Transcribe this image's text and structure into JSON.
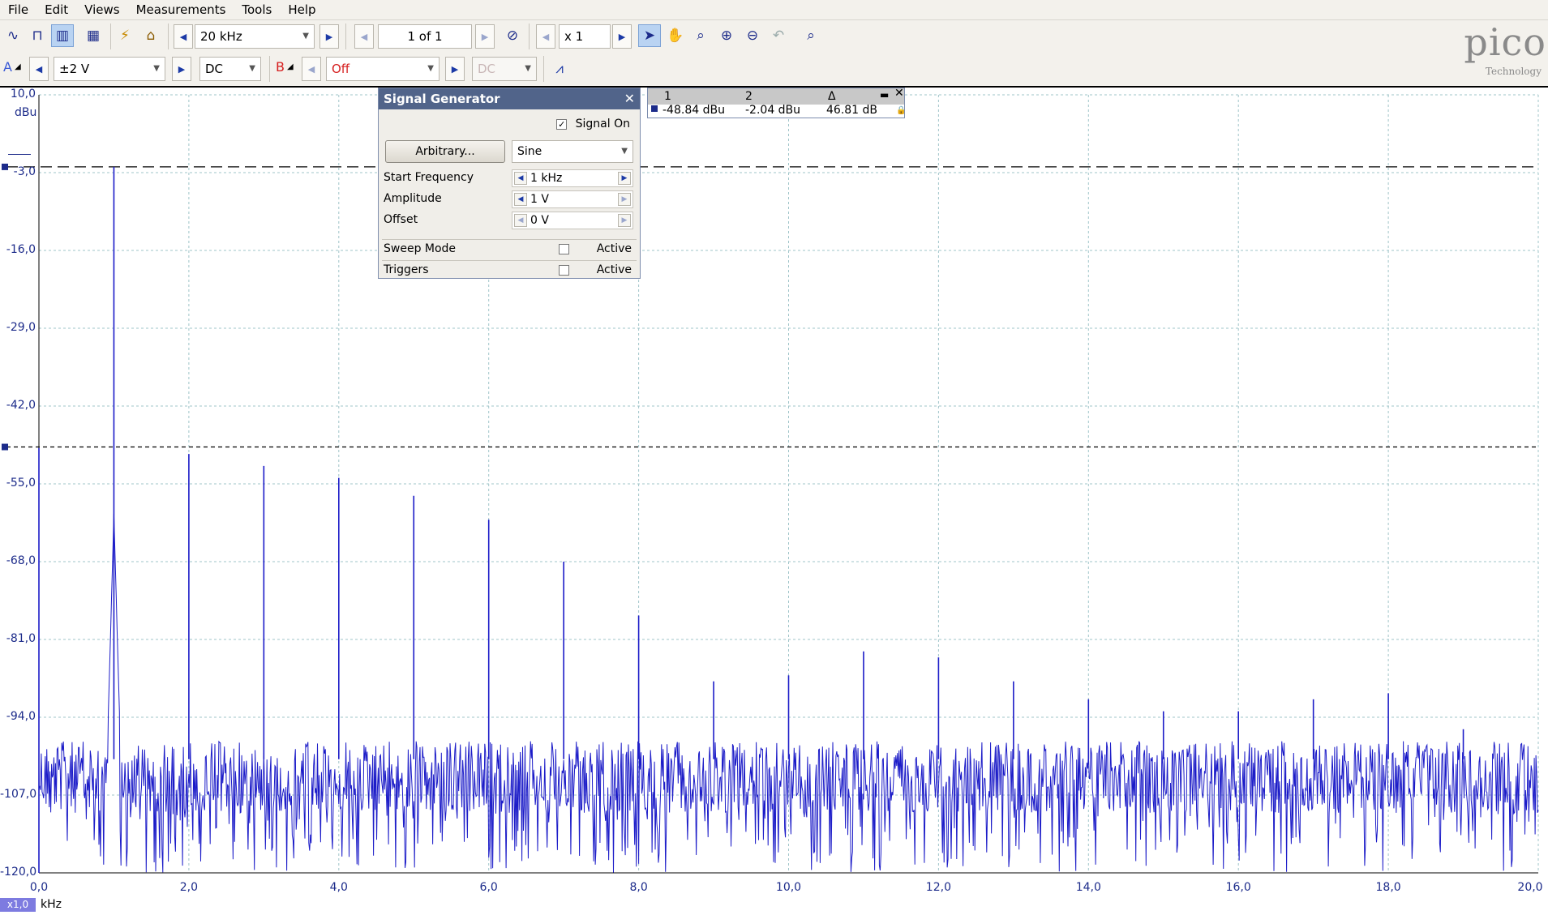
{
  "menu": [
    "File",
    "Edit",
    "Views",
    "Measurements",
    "Tools",
    "Help"
  ],
  "toolbar1": {
    "timebase": "20 kHz",
    "page": "1 of 1",
    "zoom": "x 1"
  },
  "toolbar2": {
    "channel_a_label": "A",
    "channel_a_range": "±2 V",
    "channel_a_coupling": "DC",
    "channel_b_label": "B",
    "channel_b_range": "Off",
    "channel_b_coupling": "DC"
  },
  "logo": {
    "word": "pico",
    "sub": "Technology"
  },
  "signal_generator": {
    "title": "Signal Generator",
    "signal_on_label": "Signal On",
    "signal_on": true,
    "arbitrary_button": "Arbitrary...",
    "waveform": "Sine",
    "start_frequency_label": "Start Frequency",
    "start_frequency": "1 kHz",
    "amplitude_label": "Amplitude",
    "amplitude": "1 V",
    "offset_label": "Offset",
    "offset": "0 V",
    "sweep_mode_label": "Sweep Mode",
    "triggers_label": "Triggers",
    "active_label": "Active"
  },
  "rulers": {
    "col1": "1",
    "col2": "2",
    "col3": "Δ",
    "val1": "-48.84 dBu",
    "val2": "-2.04 dBu",
    "delta": "46.81 dB"
  },
  "axis": {
    "y_unit": "dBu",
    "x_unit": "kHz",
    "x_zoom": "x1,0"
  },
  "colors": {
    "trace": "#1c1cc8",
    "axis_text": "#1c2b8a",
    "grid": "#9fc4c9",
    "titlebar": "#51648a"
  },
  "chart_data": {
    "type": "line",
    "xlabel": "kHz",
    "ylabel": "dBu",
    "xlim": [
      0,
      20
    ],
    "ylim": [
      -120,
      10
    ],
    "x_ticks": [
      "0,0",
      "2,0",
      "4,0",
      "6,0",
      "8,0",
      "10,0",
      "12,0",
      "14,0",
      "16,0",
      "18,0",
      "20,0"
    ],
    "y_ticks": [
      "10,0",
      "-3,0",
      "-16,0",
      "-29,0",
      "-42,0",
      "-55,0",
      "-68,0",
      "-81,0",
      "-94,0",
      "-107,0",
      "-120,0"
    ],
    "rulers_dbu": [
      -2.04,
      -48.84
    ],
    "noise_floor_dbu": [
      -98,
      -120
    ],
    "peaks": [
      {
        "x": 0.0,
        "y": -49
      },
      {
        "x": 1.0,
        "y": -2.04
      },
      {
        "x": 2.0,
        "y": -50
      },
      {
        "x": 3.0,
        "y": -52
      },
      {
        "x": 4.0,
        "y": -54
      },
      {
        "x": 5.0,
        "y": -57
      },
      {
        "x": 6.0,
        "y": -61
      },
      {
        "x": 7.0,
        "y": -68
      },
      {
        "x": 8.0,
        "y": -77
      },
      {
        "x": 9.0,
        "y": -88
      },
      {
        "x": 10.0,
        "y": -87
      },
      {
        "x": 11.0,
        "y": -83
      },
      {
        "x": 12.0,
        "y": -84
      },
      {
        "x": 13.0,
        "y": -88
      },
      {
        "x": 14.0,
        "y": -91
      },
      {
        "x": 15.0,
        "y": -93
      },
      {
        "x": 16.0,
        "y": -93
      },
      {
        "x": 17.0,
        "y": -91
      },
      {
        "x": 18.0,
        "y": -90
      },
      {
        "x": 19.0,
        "y": -96
      }
    ]
  }
}
